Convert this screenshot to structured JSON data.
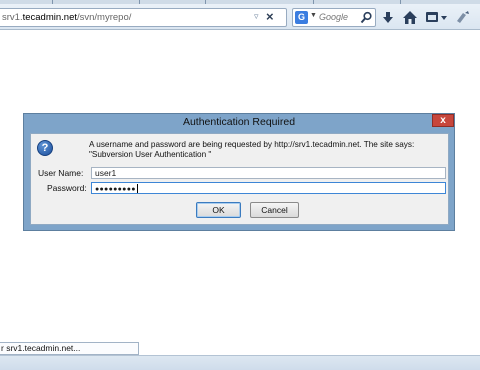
{
  "browser": {
    "url": {
      "prefix": "srv1.",
      "domain": "tecadmin.net",
      "path": "/svn/myrepo/"
    },
    "search": {
      "engine": "G",
      "placeholder": "Google"
    },
    "icons": [
      "dropmarker-icon",
      "stop-icon",
      "search-icon",
      "download-icon",
      "home-icon",
      "menu-icon",
      "addon-icon"
    ]
  },
  "dialog": {
    "title": "Authentication Required",
    "close_label": "x",
    "icon": "?",
    "message_line1": "A username and password are being requested by http://srv1.tecadmin.net. The site says:",
    "message_line2": "\"Subversion User Authentication \"",
    "username_label": "User Name:",
    "username_value": "user1",
    "password_label": "Password:",
    "password_value": "●●●●●●●●●",
    "ok_label": "OK",
    "cancel_label": "Cancel"
  },
  "status": {
    "tooltip": "r srv1.tecadmin.net..."
  },
  "colors": {
    "dialog_frame": "#7ea4c9",
    "close_button": "#c7463c",
    "focus_border": "#3d86d6"
  }
}
